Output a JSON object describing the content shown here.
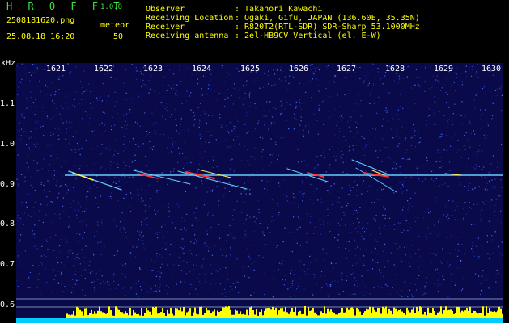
{
  "app": {
    "title": "H R O F F T",
    "version": "1.0.0"
  },
  "file": {
    "name": "2508181620.png",
    "datetime": "25.08.18 16:20"
  },
  "event": {
    "label": "meteor",
    "count": "50"
  },
  "info": [
    {
      "key": "Observer",
      "value": ": Takanori Kawachi"
    },
    {
      "key": "Receiving Location",
      "value": ": Ogaki, Gifu, JAPAN (136.60E, 35.35N)"
    },
    {
      "key": "Receiver",
      "value": ": R820T2(RTL-SDR) SDR-Sharp 53.1000MHz"
    },
    {
      "key": "Receiving antenna",
      "value": ": 2el-HB9CV Vertical (el. E-W)"
    }
  ],
  "axes": {
    "y_unit": "kHz",
    "y_ticks": [
      "1.1",
      "1.0",
      "0.9",
      "0.8",
      "0.7",
      "0.6"
    ],
    "x_ticks": [
      "1621",
      "1622",
      "1623",
      "1624",
      "1625",
      "1626",
      "1627",
      "1628",
      "1629",
      "1630"
    ]
  },
  "colors": {
    "background": "#0a0a4a",
    "carrier": "#66ccff",
    "echo_hot": "#ff3333",
    "signal_level": "#ffff00",
    "noise_floor": "#00ccff"
  }
}
